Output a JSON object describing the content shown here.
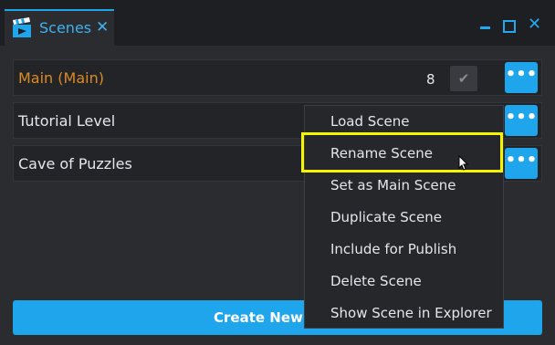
{
  "tab": {
    "title": "Scenes",
    "icon": "clapperboard-icon",
    "close_glyph": "✕"
  },
  "window_controls": {
    "close_glyph": "✕"
  },
  "scenes": [
    {
      "label": "Main (Main)",
      "count": "8",
      "is_main": true
    },
    {
      "label": "Tutorial Level"
    },
    {
      "label": "Cave of Puzzles"
    }
  ],
  "more_glyph": "•••",
  "check_glyph": "✔",
  "create_button": {
    "label": "Create New S"
  },
  "context_menu": {
    "items": [
      "Load Scene",
      "Rename Scene",
      "Set as Main Scene",
      "Duplicate Scene",
      "Include for Publish",
      "Delete Scene",
      "Show Scene in Explorer"
    ]
  },
  "colors": {
    "accent": "#1ea5ec",
    "main_scene": "#dc8a22",
    "highlight": "#f5f500"
  }
}
